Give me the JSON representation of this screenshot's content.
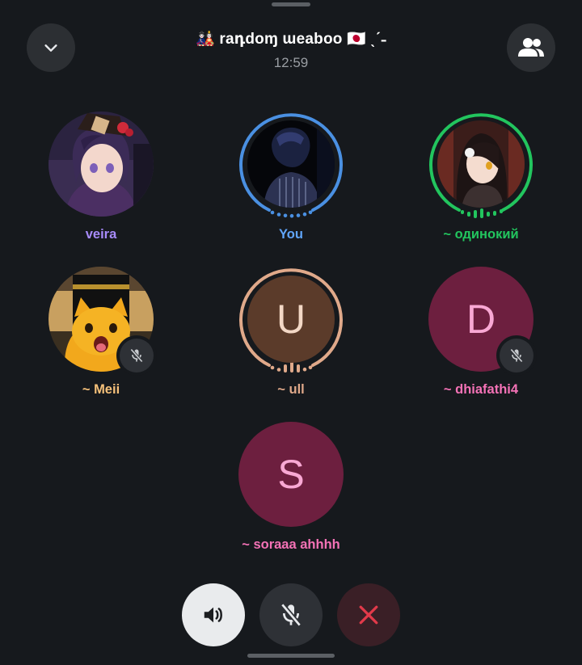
{
  "header": {
    "title": "🎎 raդdoɱ ɯeaboo 🇯🇵 ˎˊ˗",
    "time": "12:59",
    "collapse_icon": "chevron-down-icon",
    "participants_icon": "people-icon"
  },
  "participants": [
    {
      "name": "veira",
      "color": "#a78bfa",
      "avatar": "anime-girl-witch-hat",
      "speaking": false,
      "muted": false
    },
    {
      "name": "You",
      "color": "#60a5fa",
      "avatar": "anime-boy-dark",
      "speaking": true,
      "ring_color": "#4a90e2",
      "muted": false
    },
    {
      "name": "~ одинокий",
      "color": "#22c55e",
      "avatar": "anime-girl-dark-hair",
      "speaking": true,
      "ring_color": "#22c55e",
      "muted": false
    },
    {
      "name": "~ Meii",
      "color": "#f6c17a",
      "avatar": "orange-cat",
      "speaking": false,
      "muted": true
    },
    {
      "name": "~ ull",
      "color": "#e0a98a",
      "letter": "U",
      "avatar_bg": "#5b3b2a",
      "letter_color": "#f3d8c6",
      "speaking": true,
      "ring_color": "#e0a98a",
      "muted": false
    },
    {
      "name": "~ dhiafathi4",
      "color": "#f472b6",
      "letter": "D",
      "avatar_bg": "#6d1f3f",
      "letter_color": "#f9a8d4",
      "speaking": false,
      "muted": true
    },
    {
      "name": "~ soraaa ahhhh",
      "color": "#f472b6",
      "letter": "S",
      "avatar_bg": "#6d1f3f",
      "letter_color": "#f9a8d4",
      "speaking": false,
      "muted": false
    }
  ],
  "controls": {
    "speaker_icon": "speaker-icon",
    "mic_icon": "mic-off-icon",
    "end_icon": "close-icon"
  },
  "colors": {
    "background": "#16191d",
    "button_bg": "#2c2f33",
    "end_call_red": "#e23a4a"
  }
}
